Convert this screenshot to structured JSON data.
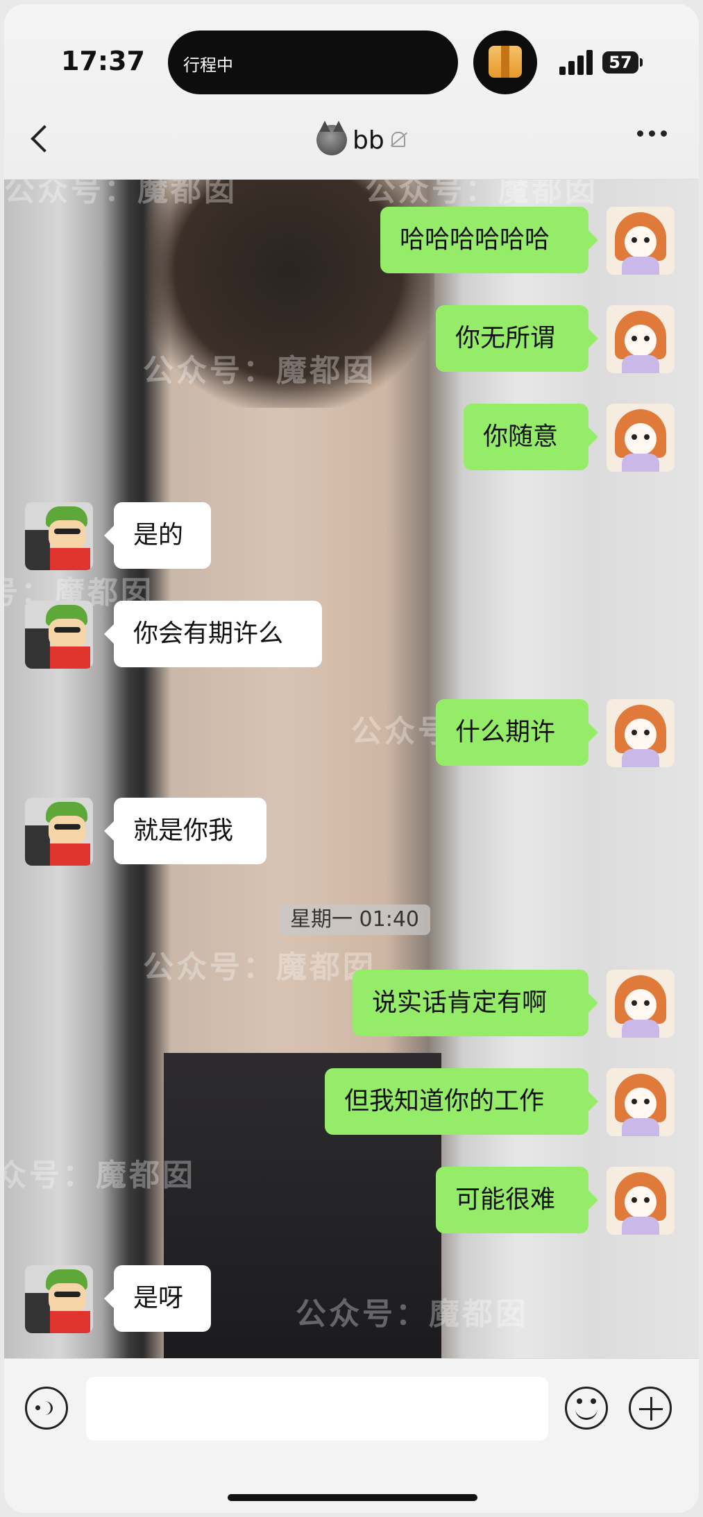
{
  "status_bar": {
    "time": "17:37",
    "island_text": "行程中",
    "battery": "57"
  },
  "header": {
    "title": "bb"
  },
  "watermark": "公众号：魔都囡",
  "messages": [
    {
      "side": "sent",
      "text": "哈哈哈哈哈哈"
    },
    {
      "side": "sent",
      "text": "你无所谓"
    },
    {
      "side": "sent",
      "text": "你随意"
    },
    {
      "side": "received",
      "text": "是的"
    },
    {
      "side": "received",
      "text": "你会有期许么"
    },
    {
      "side": "sent",
      "text": "什么期许"
    },
    {
      "side": "received",
      "text": "就是你我"
    },
    {
      "side": "sent",
      "text": "说实话肯定有啊"
    },
    {
      "side": "sent",
      "text": "但我知道你的工作"
    },
    {
      "side": "sent",
      "text": "可能很难"
    },
    {
      "side": "received",
      "text": "是呀"
    }
  ],
  "timestamp": "星期一 01:40",
  "input": {
    "placeholder": ""
  },
  "colors": {
    "sent_bubble": "#95ec69",
    "received_bubble": "#ffffff"
  }
}
